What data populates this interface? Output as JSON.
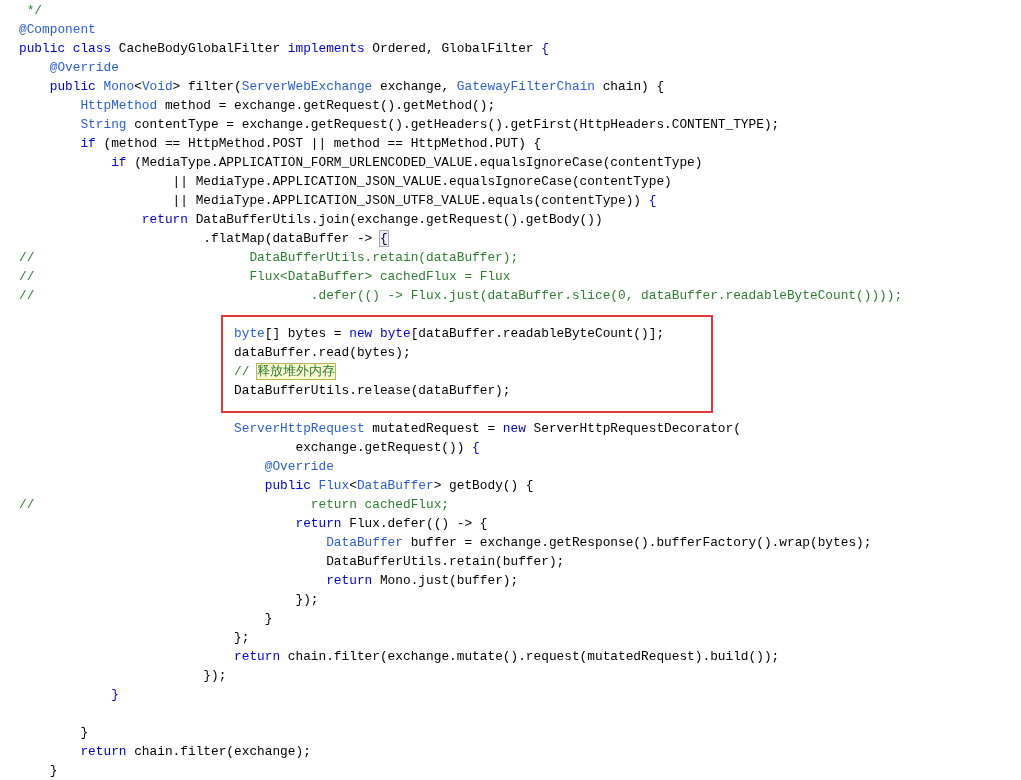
{
  "editor": {
    "blocks": [
      {
        "kind": "plain",
        "lines": [
          [
            {
              "kind": "comment",
              "text": " */"
            }
          ],
          [
            {
              "kind": "ann",
              "text": "@Component"
            }
          ],
          [
            {
              "kind": "kw",
              "text": "public class "
            },
            {
              "kind": "plain",
              "text": "CacheBodyGlobalFilter "
            },
            {
              "kind": "kw",
              "text": "implements "
            },
            {
              "kind": "plain",
              "text": "Ordered, GlobalFilter "
            },
            {
              "kind": "kw",
              "text": "{"
            }
          ],
          [
            {
              "kind": "ann",
              "text": "    @Override"
            }
          ],
          [
            {
              "kind": "kw",
              "text": "    public "
            },
            {
              "kind": "type",
              "text": "Mono"
            },
            {
              "kind": "plain",
              "text": "<"
            },
            {
              "kind": "type",
              "text": "Void"
            },
            {
              "kind": "plain",
              "text": "> filter("
            },
            {
              "kind": "type",
              "text": "ServerWebExchange"
            },
            {
              "kind": "plain",
              "text": " exchange, "
            },
            {
              "kind": "type",
              "text": "GatewayFilterChain"
            },
            {
              "kind": "plain",
              "text": " chain) {"
            }
          ],
          [
            {
              "kind": "type",
              "text": "        HttpMethod"
            },
            {
              "kind": "plain",
              "text": " method = exchange.getRequest().getMethod();"
            }
          ],
          [
            {
              "kind": "type",
              "text": "        String"
            },
            {
              "kind": "plain",
              "text": " contentType = exchange.getRequest().getHeaders().getFirst(HttpHeaders.CONTENT_TYPE);"
            }
          ],
          [
            {
              "kind": "kw",
              "text": "        if"
            },
            {
              "kind": "plain",
              "text": " (method == HttpMethod.POST || method == HttpMethod.PUT) {"
            }
          ],
          [
            {
              "kind": "kw",
              "text": "            if"
            },
            {
              "kind": "plain",
              "text": " (MediaType.APPLICATION_FORM_URLENCODED_VALUE.equalsIgnoreCase(contentType)"
            }
          ],
          [
            {
              "kind": "plain",
              "text": "                    || MediaType.APPLICATION_JSON_VALUE.equalsIgnoreCase(contentType)"
            }
          ],
          [
            {
              "kind": "plain",
              "text": "                    || MediaType.APPLICATION_JSON_UTF8_VALUE.equals(contentType)) "
            },
            {
              "kind": "kw",
              "text": "{"
            }
          ],
          [
            {
              "kind": "kw",
              "text": "                return"
            },
            {
              "kind": "plain",
              "text": " DataBufferUtils.join(exchange.getRequest().getBody())"
            }
          ],
          [
            {
              "kind": "plain",
              "text": "                        .flatMap(dataBuffer -> "
            },
            {
              "kind": "match",
              "text": "{"
            }
          ],
          [
            {
              "kind": "comment",
              "text": "//                            DataBufferUtils.retain(dataBuffer);"
            }
          ],
          [
            {
              "kind": "comment",
              "text": "//                            Flux<DataBuffer> cachedFlux = Flux"
            }
          ],
          [
            {
              "kind": "comment",
              "text": "//                                    .defer(() -> Flux.just(dataBuffer.slice(0, dataBuffer.readableByteCount())));"
            }
          ]
        ]
      },
      {
        "kind": "boxed",
        "lines": [
          [
            {
              "kind": "type",
              "text": "                            byte"
            },
            {
              "kind": "plain",
              "text": "[] bytes = "
            },
            {
              "kind": "kw",
              "text": "new byte"
            },
            {
              "kind": "plain",
              "text": "[dataBuffer.readableByteCount()];"
            }
          ],
          [
            {
              "kind": "plain",
              "text": "                            dataBuffer.read(bytes);"
            }
          ],
          [
            {
              "kind": "comment",
              "text": "                            // "
            },
            {
              "kind": "marked",
              "text": "释放堆外内存"
            }
          ],
          [
            {
              "kind": "plain",
              "text": "                            DataBufferUtils.release(dataBuffer);"
            }
          ]
        ]
      },
      {
        "kind": "plain",
        "lines": [
          [
            {
              "kind": "type",
              "text": "                            ServerHttpRequest"
            },
            {
              "kind": "plain",
              "text": " mutatedRequest = "
            },
            {
              "kind": "kw",
              "text": "new "
            },
            {
              "kind": "plain",
              "text": "ServerHttpRequestDecorator("
            }
          ],
          [
            {
              "kind": "plain",
              "text": "                                    exchange.getRequest()) "
            },
            {
              "kind": "kw",
              "text": "{"
            }
          ],
          [
            {
              "kind": "ann",
              "text": "                                @Override"
            }
          ],
          [
            {
              "kind": "kw",
              "text": "                                public "
            },
            {
              "kind": "type",
              "text": "Flux"
            },
            {
              "kind": "plain",
              "text": "<"
            },
            {
              "kind": "type",
              "text": "DataBuffer"
            },
            {
              "kind": "plain",
              "text": "> getBody() {"
            }
          ],
          [
            {
              "kind": "comment",
              "text": "//                                    return cachedFlux;"
            }
          ],
          [
            {
              "kind": "kw",
              "text": "                                    return"
            },
            {
              "kind": "plain",
              "text": " Flux.defer(() -> {"
            }
          ],
          [
            {
              "kind": "type",
              "text": "                                        DataBuffer"
            },
            {
              "kind": "plain",
              "text": " buffer = exchange.getResponse().bufferFactory().wrap(bytes);"
            }
          ],
          [
            {
              "kind": "plain",
              "text": "                                        DataBufferUtils.retain(buffer);"
            }
          ],
          [
            {
              "kind": "kw",
              "text": "                                        return"
            },
            {
              "kind": "plain",
              "text": " Mono.just(buffer);"
            }
          ],
          [
            {
              "kind": "plain",
              "text": "                                    });"
            }
          ],
          [
            {
              "kind": "plain",
              "text": "                                }"
            }
          ],
          [
            {
              "kind": "plain",
              "text": "                            };"
            }
          ],
          [
            {
              "kind": "kw",
              "text": "                            return"
            },
            {
              "kind": "plain",
              "text": " chain.filter(exchange.mutate().request(mutatedRequest).build());"
            }
          ],
          [
            {
              "kind": "plain",
              "text": "                        });"
            }
          ],
          [
            {
              "kind": "kw",
              "text": "            }"
            }
          ]
        ]
      },
      {
        "kind": "spaced",
        "lines": [
          [
            {
              "kind": "plain",
              "text": "        }"
            }
          ],
          [
            {
              "kind": "kw",
              "text": "        return"
            },
            {
              "kind": "plain",
              "text": " chain.filter(exchange);"
            }
          ],
          [
            {
              "kind": "plain",
              "text": "    }"
            }
          ]
        ]
      }
    ]
  }
}
